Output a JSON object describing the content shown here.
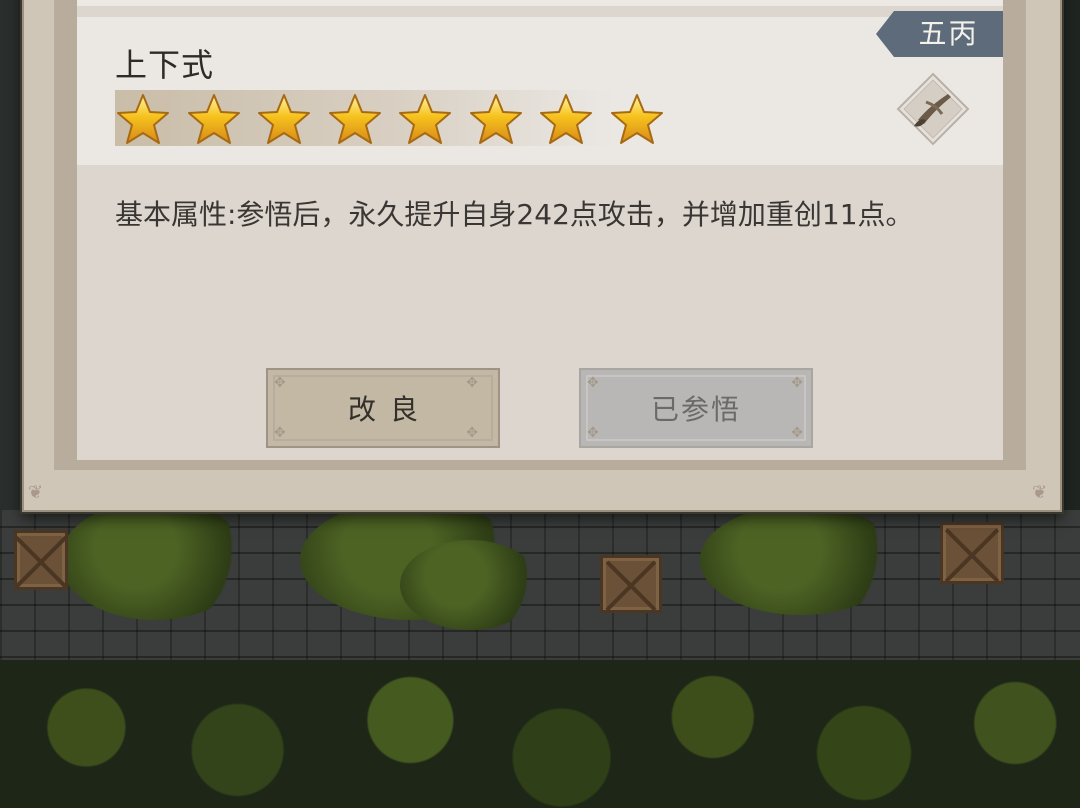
{
  "skill": {
    "name": "上下式",
    "grade": "五丙",
    "star_count": 8,
    "type_icon": "brush-icon",
    "description": "基本属性:参悟后，永久提升自身242点攻击，并增加重创11点。"
  },
  "buttons": {
    "improve_label": "改良",
    "comprehended_label": "已参悟"
  },
  "colors": {
    "grade_tag": "#5d6b7b",
    "star_gold": "#f6c21c",
    "panel": "#dcd6cf"
  }
}
